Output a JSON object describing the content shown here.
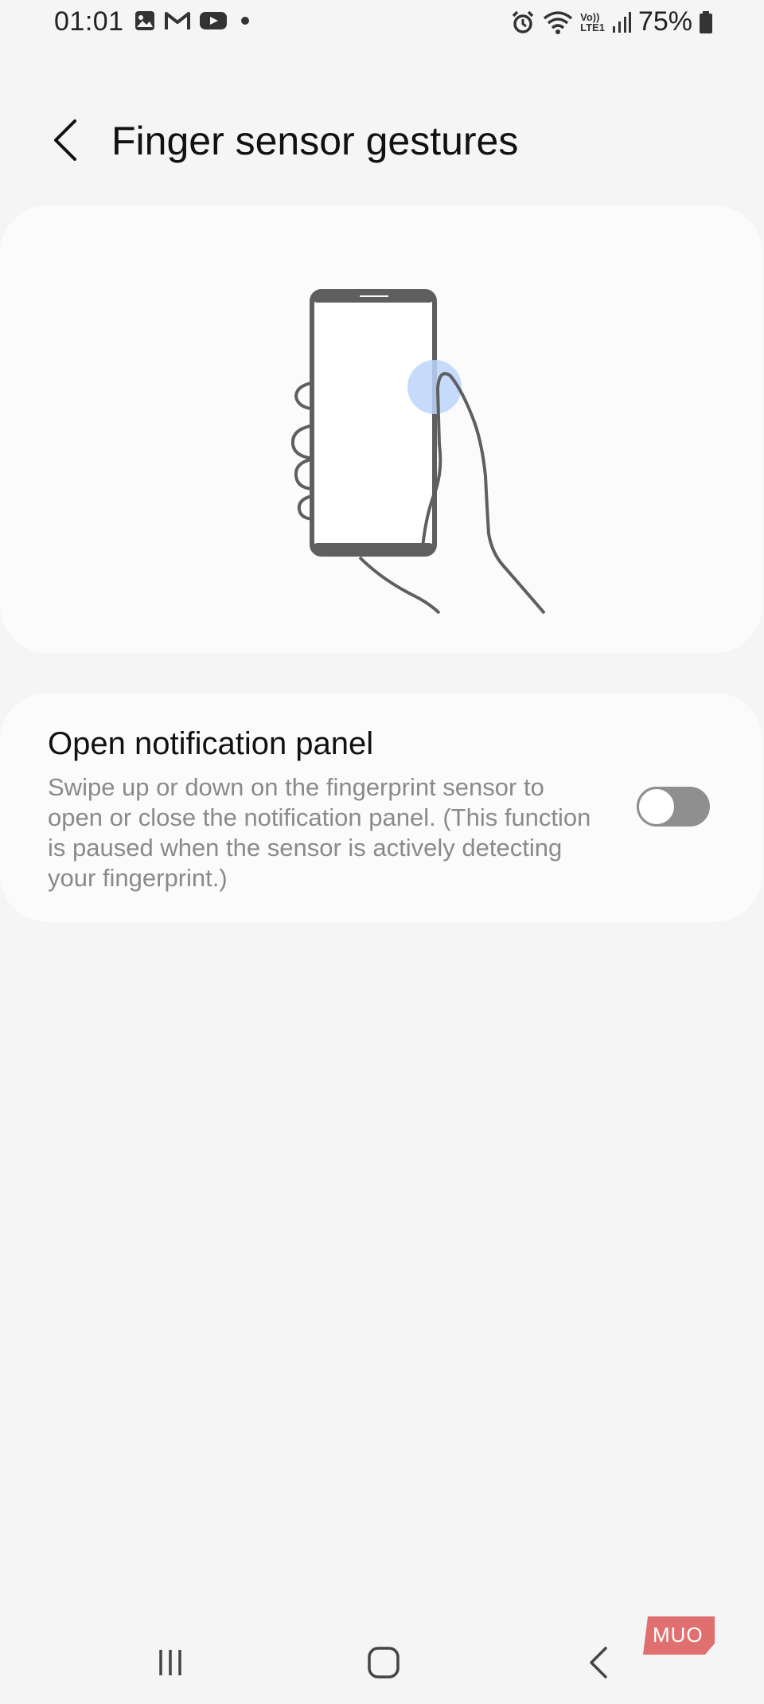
{
  "status_bar": {
    "time": "01:01",
    "battery_percent": "75%",
    "left_icons": [
      "gallery-icon",
      "gmail-icon",
      "youtube-icon",
      "dot-icon"
    ],
    "right_icons": [
      "alarm-icon",
      "wifi-icon",
      "volte-lte-icon",
      "signal-icon",
      "battery-icon"
    ],
    "volte_label_top": "Vo))",
    "volte_label_bottom": "LTE1"
  },
  "header": {
    "title": "Finger sensor gestures"
  },
  "illustration": {
    "description_icon": "hand-holding-phone-illustration",
    "accent_color": "#bcd5fb"
  },
  "setting": {
    "title": "Open notification panel",
    "description": "Swipe up or down on the fingerprint sensor to open or close the notification panel. (This function is paused when the sensor is actively detecting your fingerprint.)",
    "enabled": false
  },
  "nav_bar": {
    "recents_icon": "recents-icon",
    "home_icon": "home-icon",
    "back_icon": "back-icon"
  },
  "watermark": {
    "text": "MUO",
    "color": "#e07070"
  }
}
